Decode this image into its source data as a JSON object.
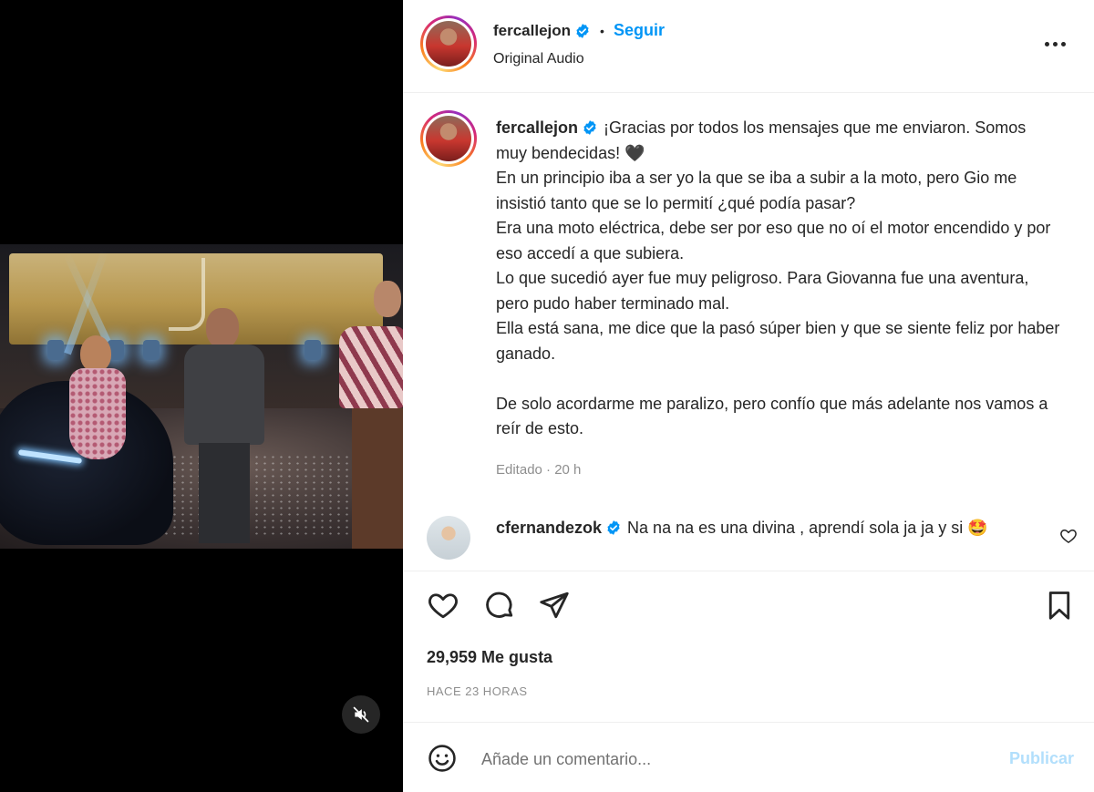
{
  "post": {
    "username": "fercallejon",
    "follow_label": "Seguir",
    "separator": "•",
    "audio_label": "Original Audio"
  },
  "caption": {
    "username": "fercallejon",
    "text": "¡Gracias por todos los mensajes que me enviaron. Somos muy bendecidas! 🖤\nEn un principio iba a ser yo la que se iba a subir a la moto, pero Gio me insistió tanto que se lo permití ¿qué podía pasar?\nEra una moto eléctrica, debe ser por eso que no oí el motor encendido y por eso accedí a que subiera.\nLo que sucedió ayer fue muy peligroso. Para Giovanna fue una aventura, pero pudo haber terminado mal.\nElla está sana, me dice que la pasó súper bien y que se siente feliz por haber ganado.\n\nDe solo acordarme me paralizo, pero confío que más adelante nos vamos a reír de esto.",
    "meta": "Editado · 20 h"
  },
  "comment": {
    "username": "cfernandezok",
    "text": "Na na na es una divina , aprendí sola ja ja y si 🤩"
  },
  "stats": {
    "likes": "29,959 Me gusta",
    "time": "HACE 23 HORAS"
  },
  "add_comment": {
    "placeholder": "Añade un comentario...",
    "publish_label": "Publicar"
  },
  "icons": {
    "verified": "verified-badge-icon",
    "more": "more-options-icon",
    "like": "heart-icon",
    "comment": "comment-icon",
    "share": "send-icon",
    "save": "bookmark-icon",
    "emoji": "emoji-icon",
    "mute": "muted-speaker-icon"
  },
  "colors": {
    "accent": "#0095f6",
    "publish_disabled": "#b2dffc",
    "muted_text": "#8e8e8e"
  }
}
